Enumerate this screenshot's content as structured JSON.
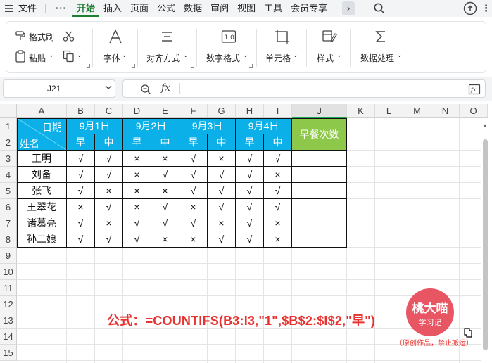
{
  "menu": {
    "items": [
      {
        "label": "文件"
      },
      {
        "label": "···"
      },
      {
        "label": "开始",
        "active": true
      },
      {
        "label": "插入"
      },
      {
        "label": "页面"
      },
      {
        "label": "公式"
      },
      {
        "label": "数据"
      },
      {
        "label": "审阅"
      },
      {
        "label": "视图"
      },
      {
        "label": "工具"
      },
      {
        "label": "会员专享"
      }
    ],
    "more_right": "⋮"
  },
  "ribbon": {
    "format_painter": "格式刷",
    "paste": "粘贴",
    "font": "字体",
    "align": "对齐方式",
    "number_format": "数字格式",
    "cells": "单元格",
    "styles": "样式",
    "data_processing": "数据处理"
  },
  "formula_bar": {
    "cell_ref": "J21",
    "fx": "fx",
    "formula": ""
  },
  "sheet": {
    "columns": [
      "A",
      "B",
      "C",
      "D",
      "E",
      "F",
      "G",
      "H",
      "I",
      "J",
      "K",
      "L",
      "M",
      "N",
      "O"
    ],
    "selected_column": "J",
    "rows": [
      "1",
      "2",
      "3",
      "4",
      "5",
      "6",
      "7",
      "8",
      "9",
      "10",
      "11",
      "12",
      "13",
      "14",
      "15"
    ]
  },
  "table": {
    "header_date": "日期",
    "header_name": "姓名",
    "dates": [
      "9月1日",
      "9月2日",
      "9月3日",
      "9月4日"
    ],
    "meal_labels": [
      "早",
      "中",
      "早",
      "中",
      "早",
      "中",
      "早",
      "中"
    ],
    "result_header": "早餐次数",
    "rows": [
      {
        "name": "王明",
        "marks": [
          "√",
          "√",
          "×",
          "×",
          "√",
          "×",
          "√",
          "√"
        ]
      },
      {
        "name": "刘备",
        "marks": [
          "√",
          "√",
          "×",
          "√",
          "√",
          "√",
          "√",
          "×"
        ]
      },
      {
        "name": "张飞",
        "marks": [
          "√",
          "×",
          "×",
          "×",
          "√",
          "√",
          "√",
          "√"
        ]
      },
      {
        "name": "王翠花",
        "marks": [
          "×",
          "√",
          "×",
          "√",
          "×",
          "√",
          "√",
          "√"
        ]
      },
      {
        "name": "诸葛亮",
        "marks": [
          "√",
          "×",
          "√",
          "√",
          "√",
          "×",
          "√",
          "×"
        ]
      },
      {
        "name": "孙二娘",
        "marks": [
          "√",
          "√",
          "√",
          "×",
          "×",
          "√",
          "√",
          "×"
        ]
      }
    ]
  },
  "annotation": {
    "formula_text": "公式：=COUNTIFS(B3:I3,\"1\",$B$2:$I$2,\"早\")"
  },
  "watermark": {
    "line1": "桃大喵",
    "line2": "学习记",
    "note": "（原创作品，禁止搬运）"
  },
  "colors": {
    "accent": "#1e7e34",
    "header_blue": "#0bb0e8",
    "header_green": "#8dc84a",
    "annotation_red": "#e8322f",
    "stamp": "#e85563"
  }
}
